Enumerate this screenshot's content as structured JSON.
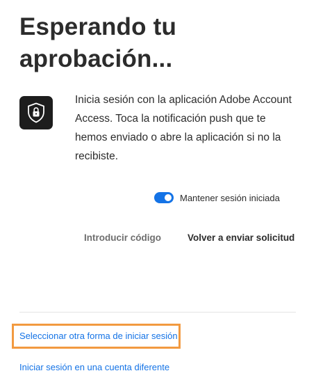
{
  "page": {
    "title": "Esperando tu aprobación..."
  },
  "approval": {
    "icon": "shield-lock-icon",
    "message": "Inicia sesión con la aplicación Adobe Account Access. Toca la notificación push que te hemos enviado o abre la aplicación si no la recibiste."
  },
  "keep_signed_in": {
    "label": "Mantener sesión iniciada",
    "enabled": true
  },
  "actions": {
    "enter_code": "Introducir código",
    "resend_request": "Volver a enviar solicitud"
  },
  "links": {
    "other_method": "Seleccionar otra forma de iniciar sesión",
    "different_account": "Iniciar sesión en una cuenta diferente"
  },
  "colors": {
    "accent": "#1473e6",
    "highlight": "#f29a40",
    "text": "#2c2c2c"
  }
}
